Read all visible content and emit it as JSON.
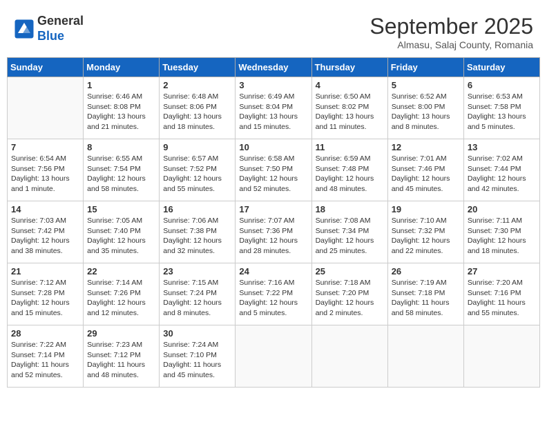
{
  "logo": {
    "line1": "General",
    "line2": "Blue"
  },
  "title": "September 2025",
  "location": "Almasu, Salaj County, Romania",
  "days_of_week": [
    "Sunday",
    "Monday",
    "Tuesday",
    "Wednesday",
    "Thursday",
    "Friday",
    "Saturday"
  ],
  "weeks": [
    [
      {
        "day": "",
        "info": ""
      },
      {
        "day": "1",
        "info": "Sunrise: 6:46 AM\nSunset: 8:08 PM\nDaylight: 13 hours\nand 21 minutes."
      },
      {
        "day": "2",
        "info": "Sunrise: 6:48 AM\nSunset: 8:06 PM\nDaylight: 13 hours\nand 18 minutes."
      },
      {
        "day": "3",
        "info": "Sunrise: 6:49 AM\nSunset: 8:04 PM\nDaylight: 13 hours\nand 15 minutes."
      },
      {
        "day": "4",
        "info": "Sunrise: 6:50 AM\nSunset: 8:02 PM\nDaylight: 13 hours\nand 11 minutes."
      },
      {
        "day": "5",
        "info": "Sunrise: 6:52 AM\nSunset: 8:00 PM\nDaylight: 13 hours\nand 8 minutes."
      },
      {
        "day": "6",
        "info": "Sunrise: 6:53 AM\nSunset: 7:58 PM\nDaylight: 13 hours\nand 5 minutes."
      }
    ],
    [
      {
        "day": "7",
        "info": "Sunrise: 6:54 AM\nSunset: 7:56 PM\nDaylight: 13 hours\nand 1 minute."
      },
      {
        "day": "8",
        "info": "Sunrise: 6:55 AM\nSunset: 7:54 PM\nDaylight: 12 hours\nand 58 minutes."
      },
      {
        "day": "9",
        "info": "Sunrise: 6:57 AM\nSunset: 7:52 PM\nDaylight: 12 hours\nand 55 minutes."
      },
      {
        "day": "10",
        "info": "Sunrise: 6:58 AM\nSunset: 7:50 PM\nDaylight: 12 hours\nand 52 minutes."
      },
      {
        "day": "11",
        "info": "Sunrise: 6:59 AM\nSunset: 7:48 PM\nDaylight: 12 hours\nand 48 minutes."
      },
      {
        "day": "12",
        "info": "Sunrise: 7:01 AM\nSunset: 7:46 PM\nDaylight: 12 hours\nand 45 minutes."
      },
      {
        "day": "13",
        "info": "Sunrise: 7:02 AM\nSunset: 7:44 PM\nDaylight: 12 hours\nand 42 minutes."
      }
    ],
    [
      {
        "day": "14",
        "info": "Sunrise: 7:03 AM\nSunset: 7:42 PM\nDaylight: 12 hours\nand 38 minutes."
      },
      {
        "day": "15",
        "info": "Sunrise: 7:05 AM\nSunset: 7:40 PM\nDaylight: 12 hours\nand 35 minutes."
      },
      {
        "day": "16",
        "info": "Sunrise: 7:06 AM\nSunset: 7:38 PM\nDaylight: 12 hours\nand 32 minutes."
      },
      {
        "day": "17",
        "info": "Sunrise: 7:07 AM\nSunset: 7:36 PM\nDaylight: 12 hours\nand 28 minutes."
      },
      {
        "day": "18",
        "info": "Sunrise: 7:08 AM\nSunset: 7:34 PM\nDaylight: 12 hours\nand 25 minutes."
      },
      {
        "day": "19",
        "info": "Sunrise: 7:10 AM\nSunset: 7:32 PM\nDaylight: 12 hours\nand 22 minutes."
      },
      {
        "day": "20",
        "info": "Sunrise: 7:11 AM\nSunset: 7:30 PM\nDaylight: 12 hours\nand 18 minutes."
      }
    ],
    [
      {
        "day": "21",
        "info": "Sunrise: 7:12 AM\nSunset: 7:28 PM\nDaylight: 12 hours\nand 15 minutes."
      },
      {
        "day": "22",
        "info": "Sunrise: 7:14 AM\nSunset: 7:26 PM\nDaylight: 12 hours\nand 12 minutes."
      },
      {
        "day": "23",
        "info": "Sunrise: 7:15 AM\nSunset: 7:24 PM\nDaylight: 12 hours\nand 8 minutes."
      },
      {
        "day": "24",
        "info": "Sunrise: 7:16 AM\nSunset: 7:22 PM\nDaylight: 12 hours\nand 5 minutes."
      },
      {
        "day": "25",
        "info": "Sunrise: 7:18 AM\nSunset: 7:20 PM\nDaylight: 12 hours\nand 2 minutes."
      },
      {
        "day": "26",
        "info": "Sunrise: 7:19 AM\nSunset: 7:18 PM\nDaylight: 11 hours\nand 58 minutes."
      },
      {
        "day": "27",
        "info": "Sunrise: 7:20 AM\nSunset: 7:16 PM\nDaylight: 11 hours\nand 55 minutes."
      }
    ],
    [
      {
        "day": "28",
        "info": "Sunrise: 7:22 AM\nSunset: 7:14 PM\nDaylight: 11 hours\nand 52 minutes."
      },
      {
        "day": "29",
        "info": "Sunrise: 7:23 AM\nSunset: 7:12 PM\nDaylight: 11 hours\nand 48 minutes."
      },
      {
        "day": "30",
        "info": "Sunrise: 7:24 AM\nSunset: 7:10 PM\nDaylight: 11 hours\nand 45 minutes."
      },
      {
        "day": "",
        "info": ""
      },
      {
        "day": "",
        "info": ""
      },
      {
        "day": "",
        "info": ""
      },
      {
        "day": "",
        "info": ""
      }
    ]
  ]
}
